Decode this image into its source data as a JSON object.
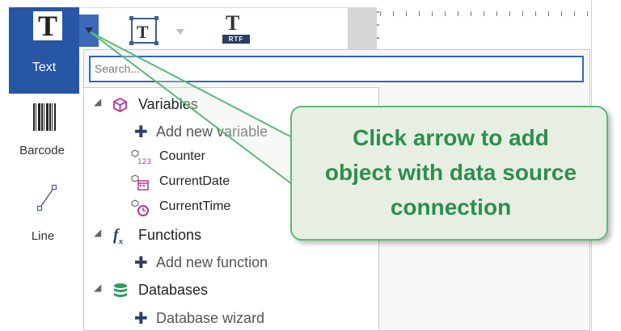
{
  "toolbox": {
    "text_label": "Text",
    "text_glyph": "T",
    "barcode_label": "Barcode",
    "line_label": "Line"
  },
  "toolbar": {
    "frame_glyph": "T",
    "rtf_glyph": "T",
    "rtf_tag": "RTF"
  },
  "search": {
    "placeholder": "Search..."
  },
  "tree": {
    "variables": {
      "label": "Variables",
      "add_label": "Add new variable",
      "items": [
        "Counter",
        "CurrentDate",
        "CurrentTime"
      ]
    },
    "functions": {
      "label": "Functions",
      "add_label": "Add new function"
    },
    "databases": {
      "label": "Databases",
      "add_label": "Database wizard"
    }
  },
  "callout": {
    "line1": "Click arrow to add",
    "line2": "object with data source",
    "line3": "connection"
  },
  "colors": {
    "accent": "#2756a4",
    "callout_text": "#2f8e4c",
    "callout_border": "#5ab978",
    "callout_fill": "#e6efe2",
    "variable_icon": "#b5339a",
    "database_icon": "#2a9d5a"
  }
}
